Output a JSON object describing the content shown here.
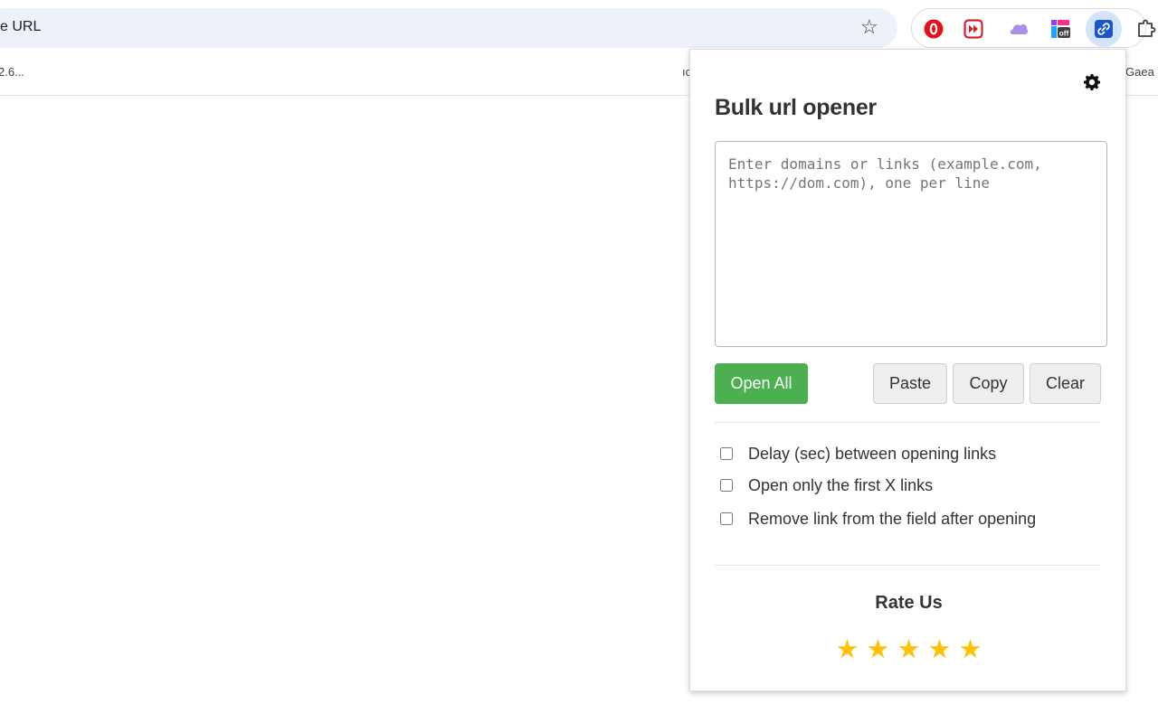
{
  "browser": {
    "omnibox_text": "e URL",
    "bookmarks": {
      "left": "2.6...",
      "middle": "ıc",
      "right": "Gaea"
    },
    "extension_icons": [
      "opera-adblock-icon",
      "video-speed-icon",
      "cloud-icon",
      "grid-off-icon",
      "link-icon",
      "puzzle-icon"
    ],
    "off_badge": "off"
  },
  "popup": {
    "title": "Bulk url opener",
    "textarea_placeholder": "Enter domains or links (example.com,\nhttps://dom.com), one per line",
    "buttons": {
      "open_all": "Open All",
      "paste": "Paste",
      "copy": "Copy",
      "clear": "Clear"
    },
    "options": [
      {
        "label": "Delay (sec) between opening links",
        "checked": false
      },
      {
        "label": "Open only the first X links",
        "checked": false
      },
      {
        "label": "Remove link from the field after opening",
        "checked": false
      }
    ],
    "rate": {
      "title": "Rate Us",
      "stars": [
        "★",
        "★",
        "★",
        "★",
        "★"
      ]
    }
  },
  "colors": {
    "accent_green": "#4caf50",
    "star_yellow": "#ffc107",
    "omnibox_bg": "#edf2fa",
    "active_ext_bg": "#d3e3fd"
  }
}
